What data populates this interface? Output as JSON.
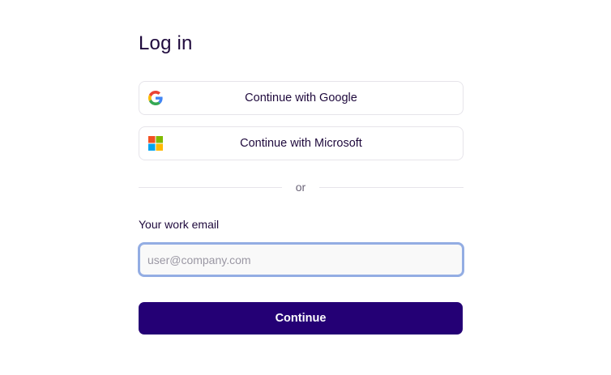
{
  "page": {
    "title": "Log in"
  },
  "sso": {
    "google": {
      "label": "Continue with Google",
      "icon": "google-icon"
    },
    "microsoft": {
      "label": "Continue with Microsoft",
      "icon": "microsoft-icon"
    }
  },
  "divider": {
    "text": "or"
  },
  "email": {
    "label": "Your work email",
    "value": "",
    "placeholder": "user@company.com"
  },
  "submit": {
    "label": "Continue"
  },
  "colors": {
    "primary": "#240075",
    "text": "#1f0a3d",
    "focus_ring": "#93ade3",
    "border": "#e6e4ea"
  }
}
